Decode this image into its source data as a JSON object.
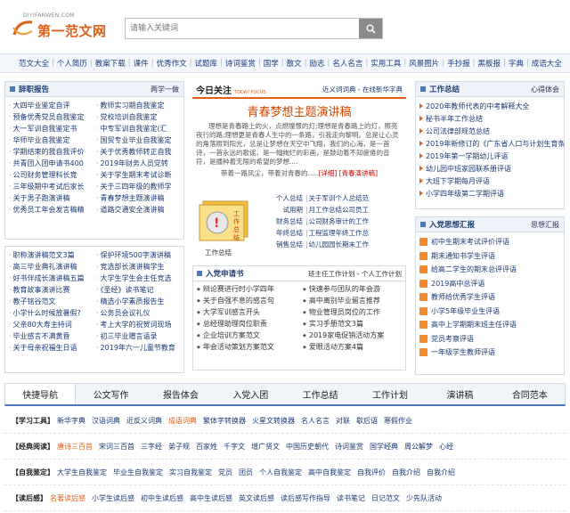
{
  "header": {
    "logo_url": "DIYIFANWEN.COM",
    "logo_name": "第一范文网",
    "search_placeholder": "请输入关键词"
  },
  "nav": [
    "范文大全",
    "个人简历",
    "教案下载",
    "课件",
    "优秀作文",
    "试题库",
    "诗词鉴赏",
    "国学",
    "散文",
    "励志",
    "名人名言",
    "实用工具",
    "风景图片",
    "手抄报",
    "黑板报",
    "字典",
    "成语大全"
  ],
  "left1": {
    "title": "辞职报告",
    "more": "两学一做",
    "items": [
      [
        "大四毕业鉴定自评",
        "教师实习期自我鉴定"
      ],
      [
        "预备优秀党员自我鉴定",
        "党校培训自我鉴定"
      ],
      [
        "大一军训自我鉴定书",
        "中专军训自我鉴定(汇"
      ],
      [
        "华师毕业自我鉴定",
        "国贸专业毕业自我鉴定"
      ],
      [
        "学期结束的我自我评价",
        "关于优秀教师转正自我"
      ],
      [
        "共青团入团申请书400",
        "2019年财务人员党转"
      ],
      [
        "公司财务管理科长竞",
        "关于学生期末考试诊断"
      ],
      [
        "三年级期中考试后家长",
        "关于三四年级的教师学"
      ],
      [
        "关于男子跑演讲稿",
        "青春梦想主题演讲稿"
      ],
      [
        "优秀员工年会发言稿精",
        "道路交通安全演讲稿"
      ]
    ]
  },
  "left2": {
    "items": [
      [
        "职称演讲稿范文3篇",
        "保护环境500字演讲稿"
      ],
      [
        "高三毕业典礼演讲稿",
        "竞选部长演讲稿学生"
      ],
      [
        "好书伴成长演讲稿五篇",
        "大学生学生会主任竞选"
      ],
      [
        "教育故事演讲比赛",
        "《圣经》读书笔记"
      ],
      [
        "教子铭谷范文",
        "精选小学素质报告生"
      ],
      [
        "小学什么时候放暑假?",
        "公务员会议礼仪"
      ],
      [
        "父亲80大寿主持词",
        "考上大学的祝贺词现场"
      ],
      [
        "毕业感言不满黄昏",
        "初三毕业赠言语录"
      ],
      [
        "关于母亲祝福生日语",
        "2019年六一儿童节教育"
      ]
    ]
  },
  "focus": {
    "title": "今日关注",
    "title_en": "TODAY FOCUS",
    "links": "近义词词典 - 在线新华字典",
    "headline": "青春梦想主题演讲稿",
    "body": "理想是青春路上的火，点燃憧憬的灯;理想是青春路上的灯，照亮夜行的路;理想更是青春人生中的一条路，引我走向黎明。总是让心灵的角落照到阳光，总是让梦想在天空中飞翔，我们的心海，是一首诗，一首永远的歌谣，是一幅绚烂的彩画，是鼓动着不知疲倦的音符，是播种着无限的希望的梦想....",
    "more_pre": "带着一路风尘，带着对青春的.....",
    "more_link1": "[详细]",
    "more_link2": "[青春演讲稿]"
  },
  "tools": {
    "caption": "工作总结",
    "rows": [
      {
        "cat": "个人总结",
        "v": "关于军训个人总结范"
      },
      {
        "cat": "试用期",
        "v": "月工作总结公司员工"
      },
      {
        "cat": "财务总结",
        "v": "公司财务审计的工作"
      },
      {
        "cat": "年终总结",
        "v": "工程监理年终工作总"
      },
      {
        "cat": "销售总结",
        "v": "幼儿园园长期末工作"
      }
    ]
  },
  "apply": {
    "title": "入党申请书",
    "more": "班主任工作计划 - 个人工作计划",
    "col1": [
      "辩论赛进行时小学四年",
      "关于自强不息的感言句",
      "大学军训感言开头",
      "总经理助理岗位职责",
      "企业培训方案范文",
      "年会活动策划方案范文"
    ],
    "col2": [
      "快速参与团队的年会游",
      "高中离别毕业留言推荐",
      "物业管理员岗位的工作",
      "实习手册范文3篇",
      "2019家电促销活动方案",
      "爱眼活动方案4篇"
    ]
  },
  "right1": {
    "title": "工作总结",
    "more": "心得体会",
    "items": [
      "2020年教师代表的中考解释大全",
      "秘书半年工作总结",
      "公司法律部规范总结",
      "2019年新修订的《广东省人口与计划生育条",
      "2019年第一学期幼儿评语",
      "幼儿园中班家园联系册评语",
      "大班下学期每月评语",
      "小学四年级第二学期评语"
    ]
  },
  "right2": {
    "title": "入党思想汇报",
    "more": "思想汇报",
    "items": [
      "初中生期末考试评价评语",
      "期末通知书学生评语",
      "给高二学生的期末总评评语",
      "2019高中总评语",
      "教师给优秀学生评语",
      "小学5年级毕业生评语",
      "高中上学期期末班主任评语",
      "党员考察评语",
      "一年级学生教师评语"
    ]
  },
  "tabs": [
    "快捷导航",
    "公文写作",
    "报告体会",
    "入党入团",
    "工作总结",
    "工作计划",
    "演讲稿",
    "合同范本"
  ],
  "quick": [
    {
      "label": "【学习工具】",
      "items": [
        "新华字典",
        "汉语词典",
        "近反义词典",
        "成语词典",
        "繁体字转换器",
        "火星文转换器",
        "名人名言",
        "对联",
        "歇后语",
        "寒假作业"
      ],
      "hl": 3
    },
    {
      "label": "【经典阅读】",
      "items": [
        "唐诗三百首",
        "宋词三百首",
        "三字经",
        "弟子规",
        "百家姓",
        "千字文",
        "增广贤文",
        "中国历史朝代",
        "诗词鉴赏",
        "国学经典",
        "周公解梦",
        "心经"
      ],
      "hl": 0
    },
    {
      "label": "【自我鉴定】",
      "items": [
        "大学生自我鉴定",
        "毕业生自我鉴定",
        "实习自我鉴定",
        "党员",
        "团员",
        "个人自我鉴定",
        "高中自我鉴定",
        "自我评价",
        "自我介绍",
        "自我介绍"
      ],
      "hl": -1
    },
    {
      "label": "【读后感】",
      "items": [
        "名著读后感",
        "小学生读后感",
        "初中生读后感",
        "高中生读后感",
        "英文读后感",
        "读后感写作指导",
        "读书笔记",
        "日记范文",
        "少先队活动"
      ],
      "hl": 0
    }
  ],
  "colors": {
    "accent": "#e06018",
    "link": "#1a3a74",
    "panel_head": "#eef3f9"
  }
}
